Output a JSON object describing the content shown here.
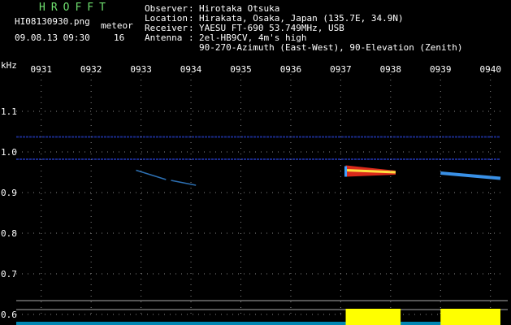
{
  "header": {
    "app_title": "HROFFT",
    "file_name": "HI08130930.png",
    "date_time": "09.08.13 09:30",
    "meteor_label": "meteor",
    "meteor_count": "16"
  },
  "station_info": [
    {
      "key": "Observer",
      "value": "Hirotaka Otsuka"
    },
    {
      "key": "Location",
      "value": "Hirakata, Osaka, Japan (135.7E, 34.9N)"
    },
    {
      "key": "Receiver",
      "value": "YAESU FT-690 53.749MHz, USB"
    },
    {
      "key": "Antenna",
      "value": "2el-HB9CV, 4m's high"
    },
    {
      "key": "",
      "value": "90-270-Azimuth (East-West), 90-Elevation (Zenith)"
    }
  ],
  "colors": {
    "background": "#000000",
    "title": "#6fe06f",
    "text": "#ffffff",
    "tick_color": "#888888",
    "noise_band": "#1a2a8a",
    "echo_hot": "#ff3020",
    "echo_mid": "#ffe040",
    "echo_cool": "#40a0ff",
    "signal_yellow": "#ffff00",
    "signal_cyan": "#00c0ff"
  },
  "chart_data": {
    "type": "heatmap",
    "ylabel": "kHz",
    "x_tick_labels": [
      "0931",
      "0932",
      "0933",
      "0934",
      "0935",
      "0936",
      "0937",
      "0938",
      "0939",
      "0940"
    ],
    "y_tick_labels": [
      "1.1",
      "1.0",
      "0.9",
      "0.8",
      "0.7",
      "0.6"
    ],
    "ylim": [
      0.59,
      1.18
    ],
    "xlim_minutes": [
      30.5,
      40.2
    ],
    "continuous_bands_khz": [
      1.037,
      0.982
    ],
    "meteor_echoes": [
      {
        "start_min": 32.9,
        "end_min": 33.5,
        "freq_start_khz": 0.955,
        "freq_end_khz": 0.932,
        "intensity": "weak"
      },
      {
        "start_min": 33.6,
        "end_min": 34.1,
        "freq_start_khz": 0.93,
        "freq_end_khz": 0.918,
        "intensity": "weak"
      },
      {
        "start_min": 37.1,
        "end_min": 38.1,
        "freq_start_khz": 0.955,
        "freq_end_khz": 0.95,
        "intensity": "strong"
      },
      {
        "start_min": 39.0,
        "end_min": 40.2,
        "freq_start_khz": 0.948,
        "freq_end_khz": 0.935,
        "intensity": "medium"
      }
    ],
    "signal_level_bursts": [
      {
        "start_min": 37.1,
        "end_min": 38.2,
        "color": "yellow"
      },
      {
        "start_min": 39.0,
        "end_min": 40.2,
        "color": "yellow"
      }
    ]
  }
}
